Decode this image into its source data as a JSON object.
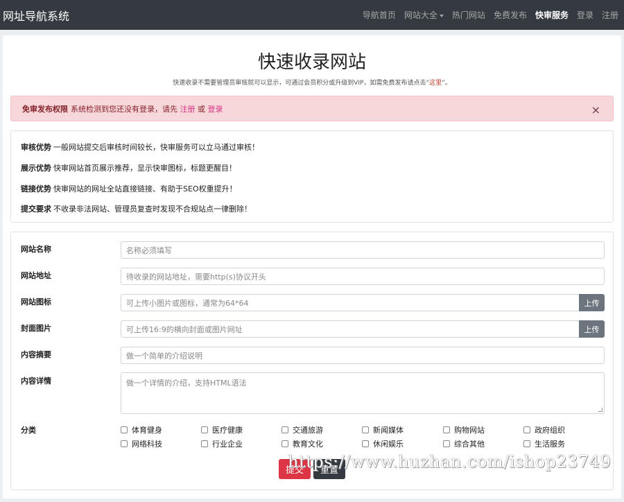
{
  "navbar": {
    "brand": "网址导航系统",
    "items": [
      {
        "label": "导航首页"
      },
      {
        "label": "网站大全"
      },
      {
        "label": "热门网站"
      },
      {
        "label": "免费发布"
      },
      {
        "label": "快审服务"
      },
      {
        "label": "登录"
      },
      {
        "label": "注册"
      }
    ]
  },
  "page": {
    "title": "快速收录网站",
    "subtitle_text": "快速收录不需要管理员审核就可以显示，可通过会员积分或升级到VIP，如需免费发布请点击“",
    "subtitle_link": "这里",
    "subtitle_end": "”。"
  },
  "alert": {
    "bold": "免审发布权限",
    "text": "系统检测到您还没有登录，请先",
    "register": "注册",
    "or": "或",
    "login": "登录",
    "close": "×"
  },
  "advantages": [
    {
      "title": "审核优势",
      "text": "一般网站提交后审核时间较长，快审服务可以立马通过审核！"
    },
    {
      "title": "展示优势",
      "text": "快审网站首页展示推荐，显示快审图标，标题更醒目！"
    },
    {
      "title": "链接优势",
      "text": "快审网站的网址全站直接链接、有助于SEO权重提升！"
    },
    {
      "title": "提交要求",
      "text": "不收录非法网站、管理员复查时发现不合规站点一律删除！"
    }
  ],
  "form": {
    "name": {
      "label": "网站名称",
      "placeholder": "名称必须填写"
    },
    "url": {
      "label": "网站地址",
      "placeholder": "待收录的网站地址，需要http(s)协议开头"
    },
    "icon": {
      "label": "网站图标",
      "placeholder": "可上传小图片或图标，通常为64*64",
      "button": "上传"
    },
    "cover": {
      "label": "封面图片",
      "placeholder": "可上传16:9的横向封面或图片网址",
      "button": "上传"
    },
    "summary": {
      "label": "内容摘要",
      "placeholder": "做一个简单的介绍说明"
    },
    "detail": {
      "label": "内容详情",
      "placeholder": "做一个详情的介绍，支持HTML语法"
    },
    "category_label": "分类",
    "categories": [
      "体育健身",
      "医疗健康",
      "交通旅游",
      "新闻媒体",
      "购物网站",
      "政府组织",
      "网络科技",
      "行业企业",
      "教育文化",
      "休闲娱乐",
      "综合其他",
      "生活服务"
    ],
    "submit": "提交",
    "reset": "重置"
  },
  "watermark": "https://www.huzhan.com/ishop23749",
  "colors": {
    "navbar": "#343a40",
    "alert_bg": "#f8d7da",
    "submit": "#dc3545",
    "reset": "#343a40",
    "upload": "#6c757d"
  }
}
